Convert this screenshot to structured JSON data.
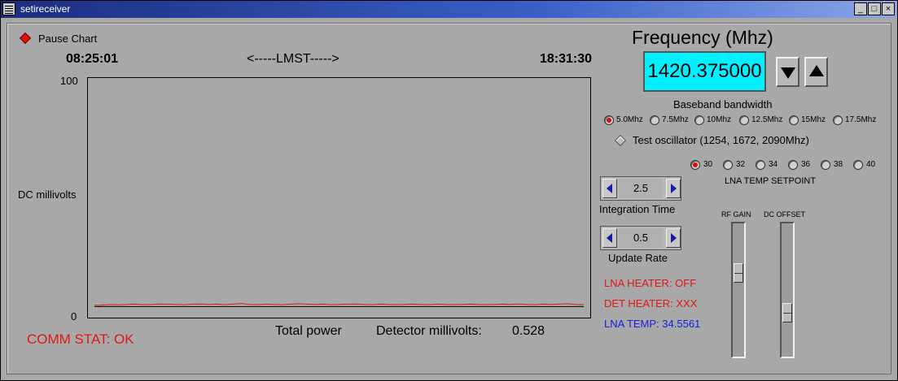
{
  "window": {
    "title": "setireceiver",
    "controls": {
      "minimize": "_",
      "maximize": "□",
      "close": "×"
    }
  },
  "pause": {
    "label": "Pause Chart",
    "checked": true
  },
  "chart": {
    "time_start": "08:25:01",
    "time_mid": "<-----LMST----->",
    "time_end": "18:31:30",
    "y_top": "100",
    "y_bottom": "0",
    "ylabel": "DC millivolts"
  },
  "chart_data": {
    "type": "line",
    "ylim": [
      0,
      100
    ],
    "ylabel": "DC millivolts",
    "series": [
      {
        "color": "#e01818",
        "values": [
          4.5,
          4.6,
          4.8,
          4.7,
          4.9,
          5.0,
          4.8,
          4.9,
          5.1,
          5.0,
          4.9,
          4.8,
          5.0,
          5.1,
          4.9,
          5.0,
          4.8,
          5.1,
          5.3,
          4.9,
          4.8,
          5.0,
          4.9,
          4.8,
          5.0,
          5.2,
          5.0,
          4.9,
          5.0,
          4.8,
          4.9,
          5.0,
          5.1,
          4.9,
          4.8,
          5.0,
          4.9,
          4.8,
          4.9,
          5.0,
          4.9,
          4.8,
          5.0,
          4.9,
          4.8,
          4.9,
          5.0,
          4.9,
          4.8,
          4.9,
          5.0,
          4.9,
          5.1,
          4.9,
          4.8,
          5.0,
          4.9,
          5.0,
          5.2,
          4.9,
          4.8
        ]
      },
      {
        "color": "#000000",
        "values": [
          4.0,
          4.0,
          4.0,
          4.0,
          4.0,
          4.0,
          4.0,
          4.0,
          4.0,
          4.0,
          4.0,
          4.0,
          4.0,
          4.0,
          4.0,
          4.0,
          4.0,
          4.0,
          4.0,
          4.0,
          4.0,
          4.0,
          4.0,
          4.0,
          4.0,
          4.0,
          4.0,
          4.0,
          4.0,
          4.0,
          4.0,
          4.0,
          4.0,
          4.0,
          4.0,
          4.0,
          4.0,
          4.0,
          4.0,
          4.0,
          4.0,
          4.0,
          4.0,
          4.0,
          4.0,
          4.0,
          4.0,
          4.0,
          4.0,
          4.0,
          4.0,
          4.0,
          4.0,
          4.0,
          4.0,
          4.0,
          4.0,
          4.0,
          4.0,
          4.0,
          4.0
        ]
      }
    ]
  },
  "status": {
    "comm": "COMM STAT:  OK",
    "total_power": "Total power",
    "detector_label": "Detector millivolts:",
    "detector_value": "0.528"
  },
  "frequency": {
    "title": "Frequency (Mhz)",
    "value": "1420.375000"
  },
  "bandwidth": {
    "label": "Baseband bandwidth",
    "options": [
      "5.0Mhz",
      "7.5Mhz",
      "10Mhz",
      "12.5Mhz",
      "15Mhz",
      "17.5Mhz"
    ],
    "selected": "5.0Mhz"
  },
  "oscillator": {
    "label": "Test oscillator (1254, 1672, 2090Mhz)",
    "checked": false
  },
  "lna_temp": {
    "label": "LNA TEMP SETPOINT",
    "options": [
      "30",
      "32",
      "34",
      "36",
      "38",
      "40"
    ],
    "selected": "30"
  },
  "integration": {
    "value": "2.5",
    "label": "Integration Time"
  },
  "update": {
    "value": "0.5",
    "label": "Update Rate"
  },
  "heater": {
    "lna": "LNA HEATER: OFF",
    "det": "DET HEATER: XXX",
    "temp": "LNA TEMP: 34.5561"
  },
  "sliders": {
    "rf_label": "RF GAIN",
    "dc_label": "DC OFFSET",
    "rf_level": 0.65,
    "dc_level": 0.3
  },
  "colors": {
    "accent_red": "#e01818",
    "accent_blue": "#1a20e0",
    "freq_bg": "#00f0ff"
  }
}
